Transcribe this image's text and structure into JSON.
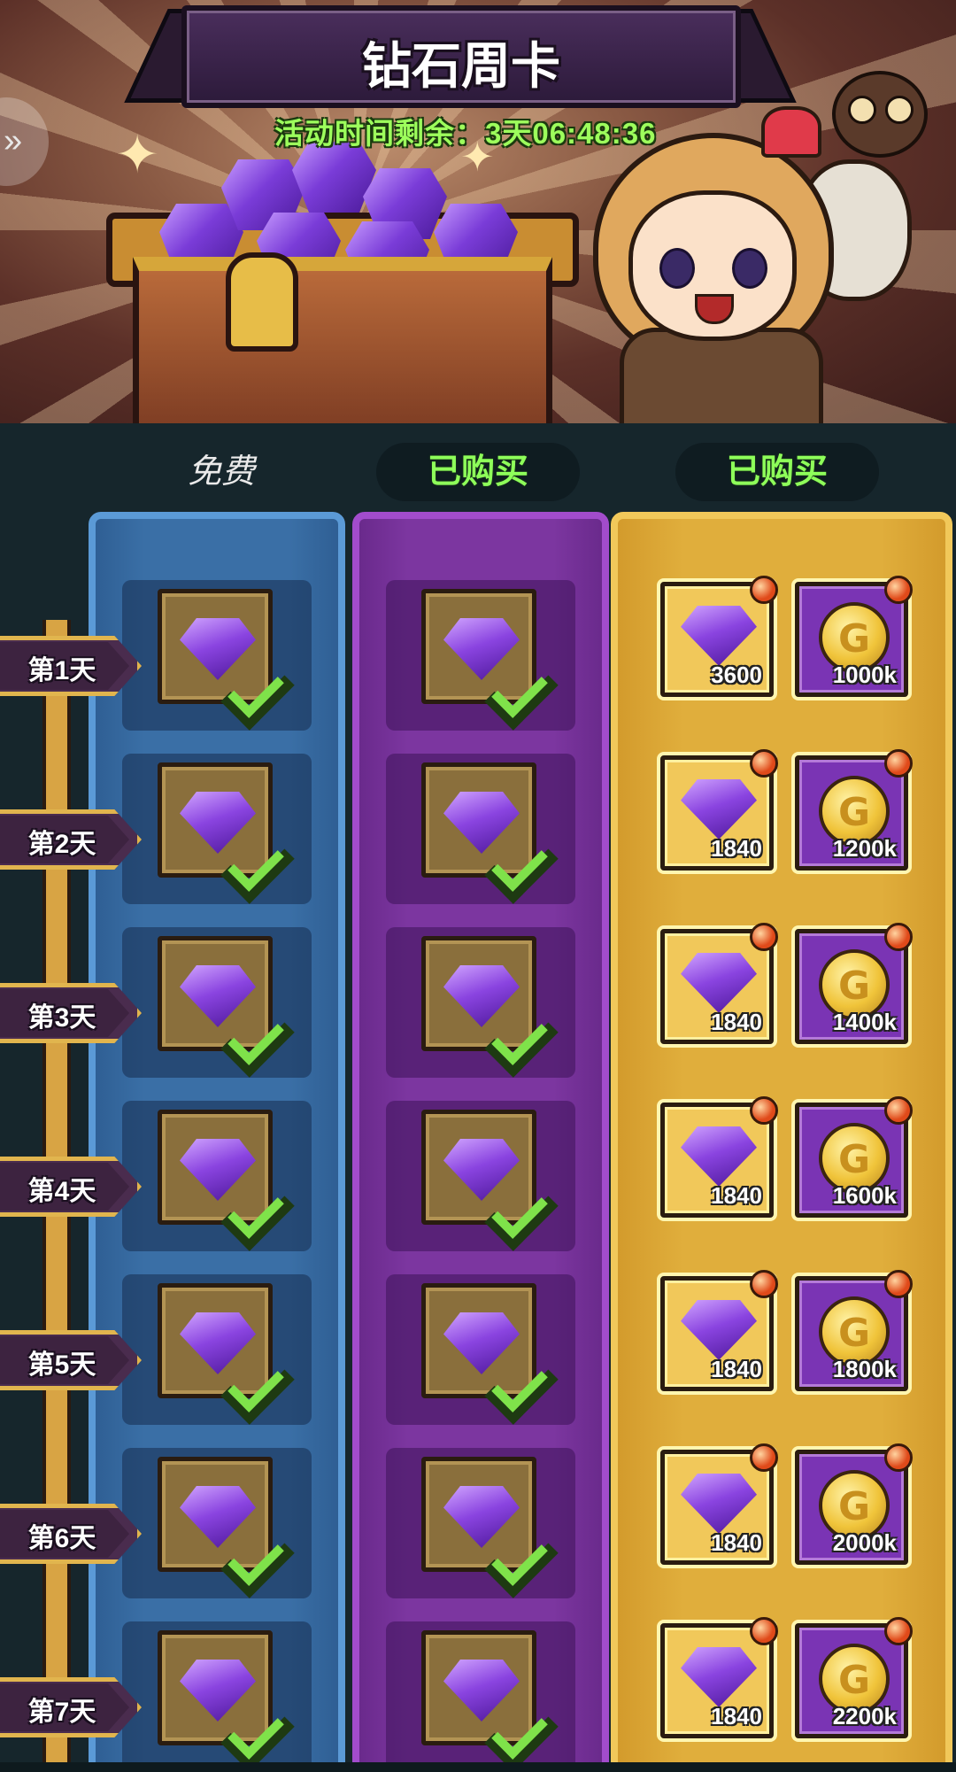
{
  "banner": {
    "title": "钻石周卡",
    "timer_text": "活动时间剩余：3天06:48:36"
  },
  "tiers": {
    "free_label": "免费",
    "tier2_label": "已购买",
    "tier3_label": "已购买"
  },
  "days": [
    {
      "label": "第1天",
      "premium_gem": "3600",
      "premium_coin": "1000k"
    },
    {
      "label": "第2天",
      "premium_gem": "1840",
      "premium_coin": "1200k"
    },
    {
      "label": "第3天",
      "premium_gem": "1840",
      "premium_coin": "1400k"
    },
    {
      "label": "第4天",
      "premium_gem": "1840",
      "premium_coin": "1600k"
    },
    {
      "label": "第5天",
      "premium_gem": "1840",
      "premium_coin": "1800k"
    },
    {
      "label": "第6天",
      "premium_gem": "1840",
      "premium_coin": "2000k"
    },
    {
      "label": "第7天",
      "premium_gem": "1840",
      "premium_coin": "2200k"
    }
  ],
  "colors": {
    "free_column": "#3a6fa6",
    "paid_column": "#7c36a0",
    "premium_column": "#e0ae3c",
    "claimed_check": "#7fe24a",
    "timer_green": "#9dff5c"
  },
  "icons": {
    "free_reward": "gem-icon",
    "paid_reward": "gem-icon",
    "premium_reward_1": "gem-icon",
    "premium_reward_2": "gold-coin-icon",
    "claimed": "checkmark-icon",
    "side_tab": "chevron-right-icon"
  }
}
